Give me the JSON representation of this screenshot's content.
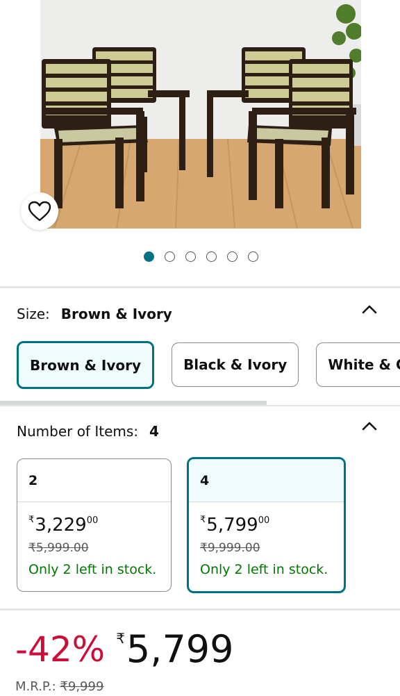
{
  "product": {
    "image_alt": "Four brown and ivory armchairs",
    "wishlist_icon": "heart-outline-icon",
    "carousel": {
      "count": 6,
      "active_index": 0
    }
  },
  "size": {
    "label": "Size:",
    "selected_value": "Brown & Ivory",
    "options": [
      "Brown & Ivory",
      "Black & Ivory",
      "White & G"
    ],
    "selected_index": 0,
    "collapse_icon": "chevron-up-icon"
  },
  "quantity": {
    "label": "Number of Items:",
    "selected_value": "4",
    "collapse_icon": "chevron-up-icon",
    "options": [
      {
        "count": "2",
        "currency": "₹",
        "price_whole": "3,229",
        "price_fraction": "00",
        "mrp": "₹5,999.00",
        "stock": "Only 2 left in stock."
      },
      {
        "count": "4",
        "currency": "₹",
        "price_whole": "5,799",
        "price_fraction": "00",
        "mrp": "₹9,999.00",
        "stock": "Only 2 left in stock."
      }
    ],
    "selected_index": 1
  },
  "price": {
    "discount": "-42%",
    "currency": "₹",
    "amount": "5,799",
    "mrp_label": "M.R.P.:",
    "mrp_value": "₹9,999"
  },
  "colors": {
    "accent": "#007185",
    "deal_red": "#cc0c39",
    "stock_green": "#007600"
  }
}
